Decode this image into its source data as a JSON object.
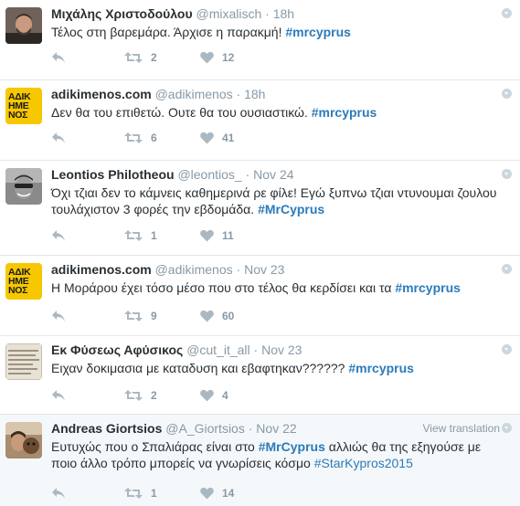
{
  "tweets": [
    {
      "name": "Μιχάλης Χριστοδούλου",
      "handle": "@mixalisch",
      "time": "18h",
      "text": "Τέλος στη βαρεμάρα. Άρχισε η παρακμή!",
      "hashtag": "#mrcyprus",
      "retweets": "2",
      "likes": "12"
    },
    {
      "name": "adikimenos.com",
      "handle": "@adikimenos",
      "time": "18h",
      "text": "Δεν θα του επιθετώ. Ουτε θα του ουσιαστικώ.",
      "hashtag": "#mrcyprus",
      "retweets": "6",
      "likes": "41",
      "logo": [
        "ΑΔΙΚ",
        "ΗΜΕ",
        "ΝΟΣ"
      ]
    },
    {
      "name": "Leontios Philotheou",
      "handle": "@leontios_",
      "time": "Nov 24",
      "text1": "Όχι τζιαι δεν το κάμνεις καθημερινά ρε φίλε! Εγώ ξυπνω τζιαι ντυνουμαι ζουλου",
      "text2": "τουλάχιστον 3 φορές την εβδομάδα.",
      "hashtag": "#MrCyprus",
      "retweets": "1",
      "likes": "11"
    },
    {
      "name": "adikimenos.com",
      "handle": "@adikimenos",
      "time": "Nov 23",
      "text": "Η Μοράρου έχει τόσο μέσο που στο τέλος θα κερδίσει και τα",
      "hashtag": "#mrcyprus",
      "retweets": "9",
      "likes": "60",
      "logo": [
        "ΑΔΙΚ",
        "ΗΜΕ",
        "ΝΟΣ"
      ]
    },
    {
      "name": "Εκ Φύσεως Αφύσικος",
      "handle": "@cut_it_all",
      "time": "Nov 23",
      "text": "Ειχαν δοκιμασια με καταδυση και εβαφτηκαν??????",
      "hashtag": "#mrcyprus",
      "retweets": "2",
      "likes": "4"
    },
    {
      "name": "Andreas Giortsios",
      "handle": "@A_Giortsios",
      "time": "Nov 22",
      "view_translation": "View translation",
      "text_a": "Ευτυχώς που ο Σπαλιάρας είναι στο",
      "hashtag_a": "#MrCyprus",
      "text_b": "αλλιώς θα της εξηγούσε με",
      "text_c": "ποιο άλλο τρόπο μπορείς να γνωρίσεις κόσμο",
      "hashtag_b": "#StarKypros2015",
      "retweets": "1",
      "likes": "14"
    }
  ],
  "dot": "·",
  "colors": {
    "link": "#2b7bb9",
    "muted": "#8899a6",
    "brand_yellow": "#f7c700"
  }
}
